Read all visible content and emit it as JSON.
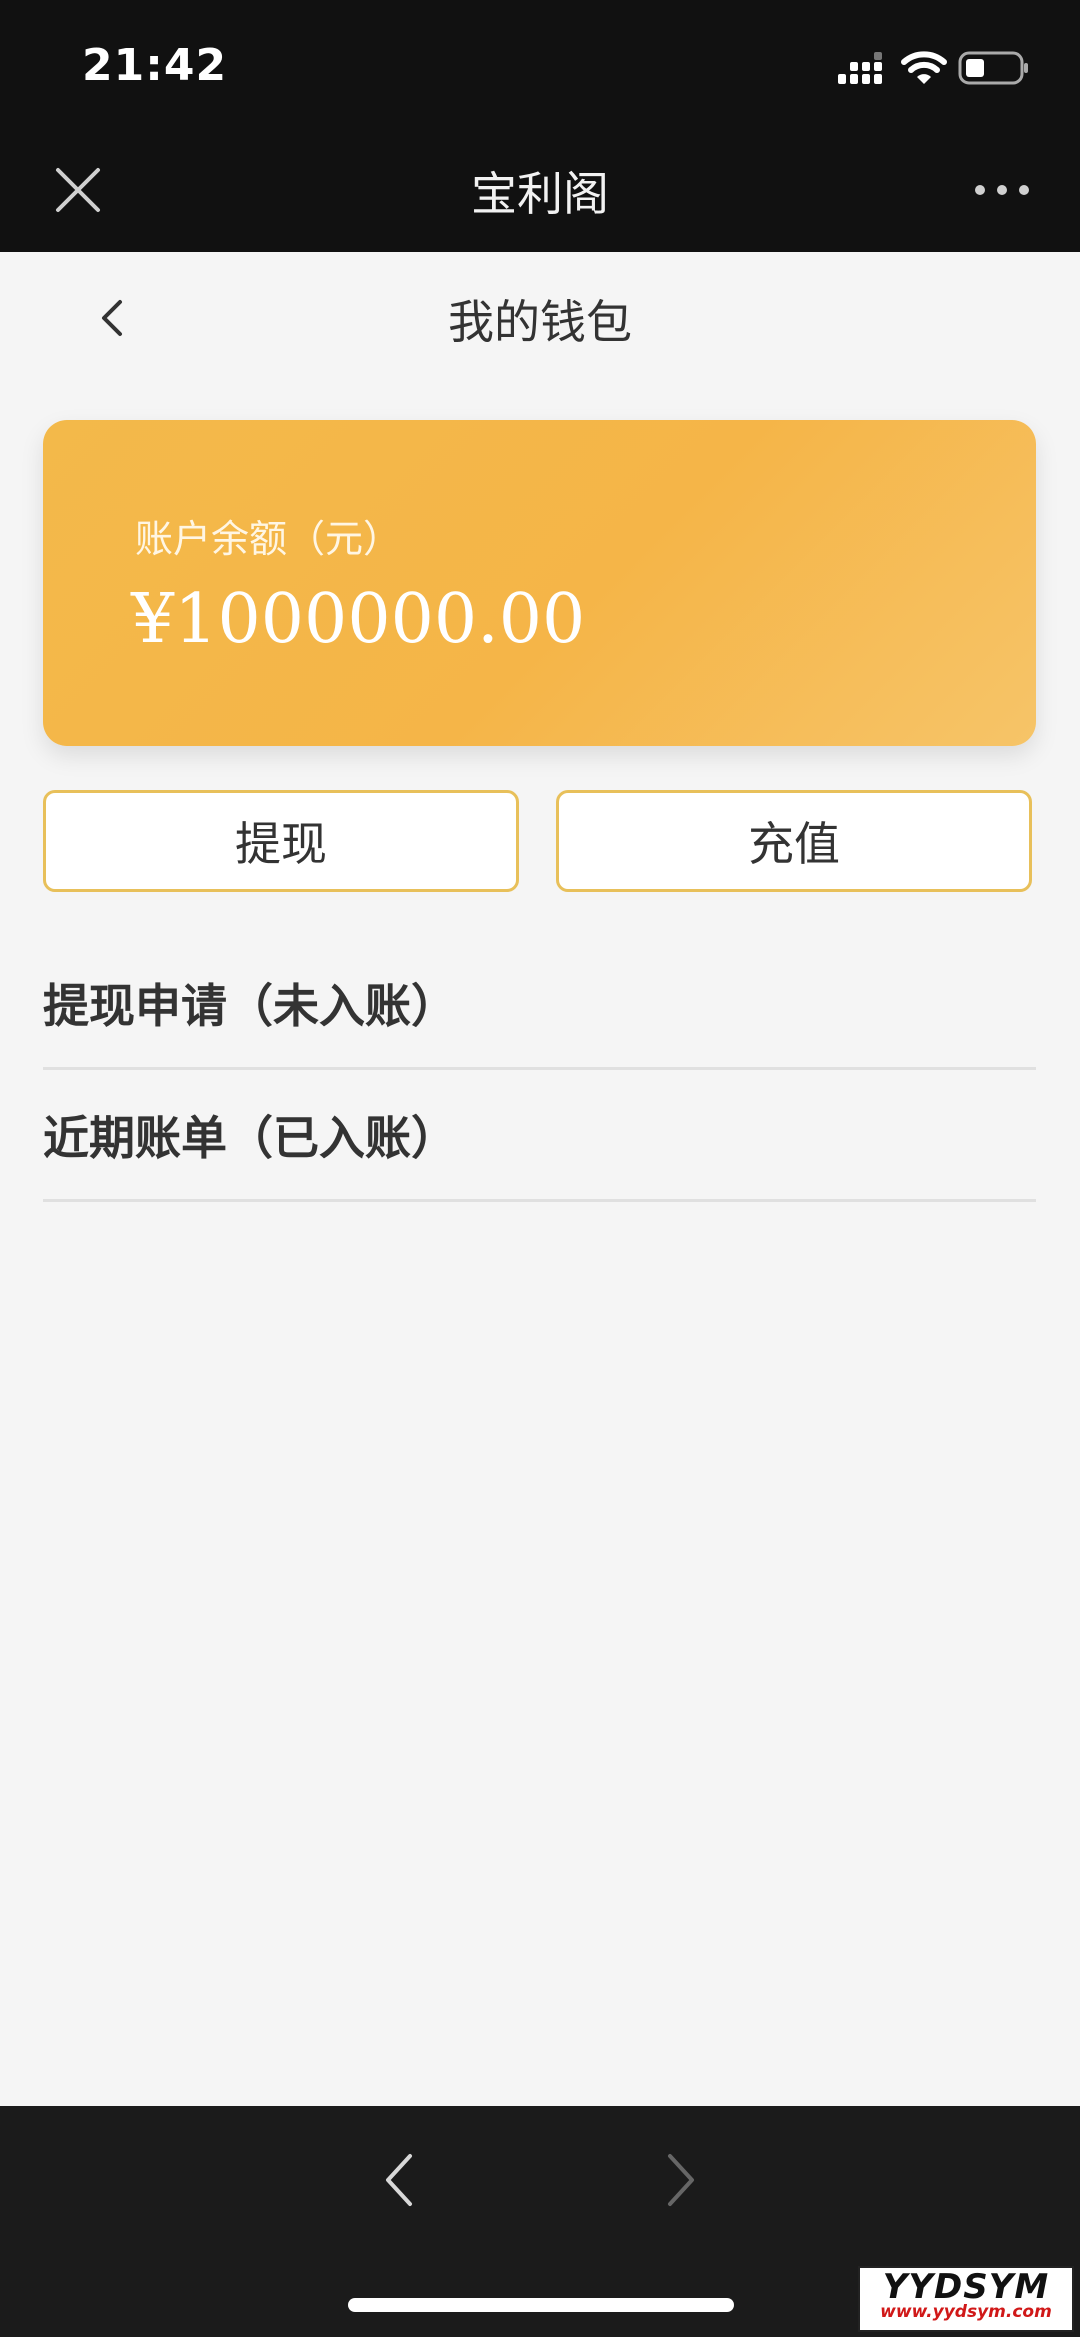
{
  "status_bar": {
    "time": "21:42"
  },
  "miniapp": {
    "title": "宝利阁"
  },
  "header": {
    "title": "我的钱包"
  },
  "wallet": {
    "balance_label": "账户余额（元）",
    "balance_amount": "¥1000000.00",
    "accent_color": "#f4b84a"
  },
  "actions": {
    "withdraw_label": "提现",
    "recharge_label": "充值"
  },
  "menu": [
    {
      "label": "提现申请（未入账）"
    },
    {
      "label": "近期账单（已入账）"
    }
  ],
  "watermark": {
    "brand": "YYDSYM",
    "url": "www.yydsym.com"
  },
  "icons": {
    "close": "close-icon",
    "more": "more-dots-icon",
    "back": "chevron-left-icon",
    "nav_back": "chevron-left-icon",
    "nav_forward": "chevron-right-icon"
  }
}
